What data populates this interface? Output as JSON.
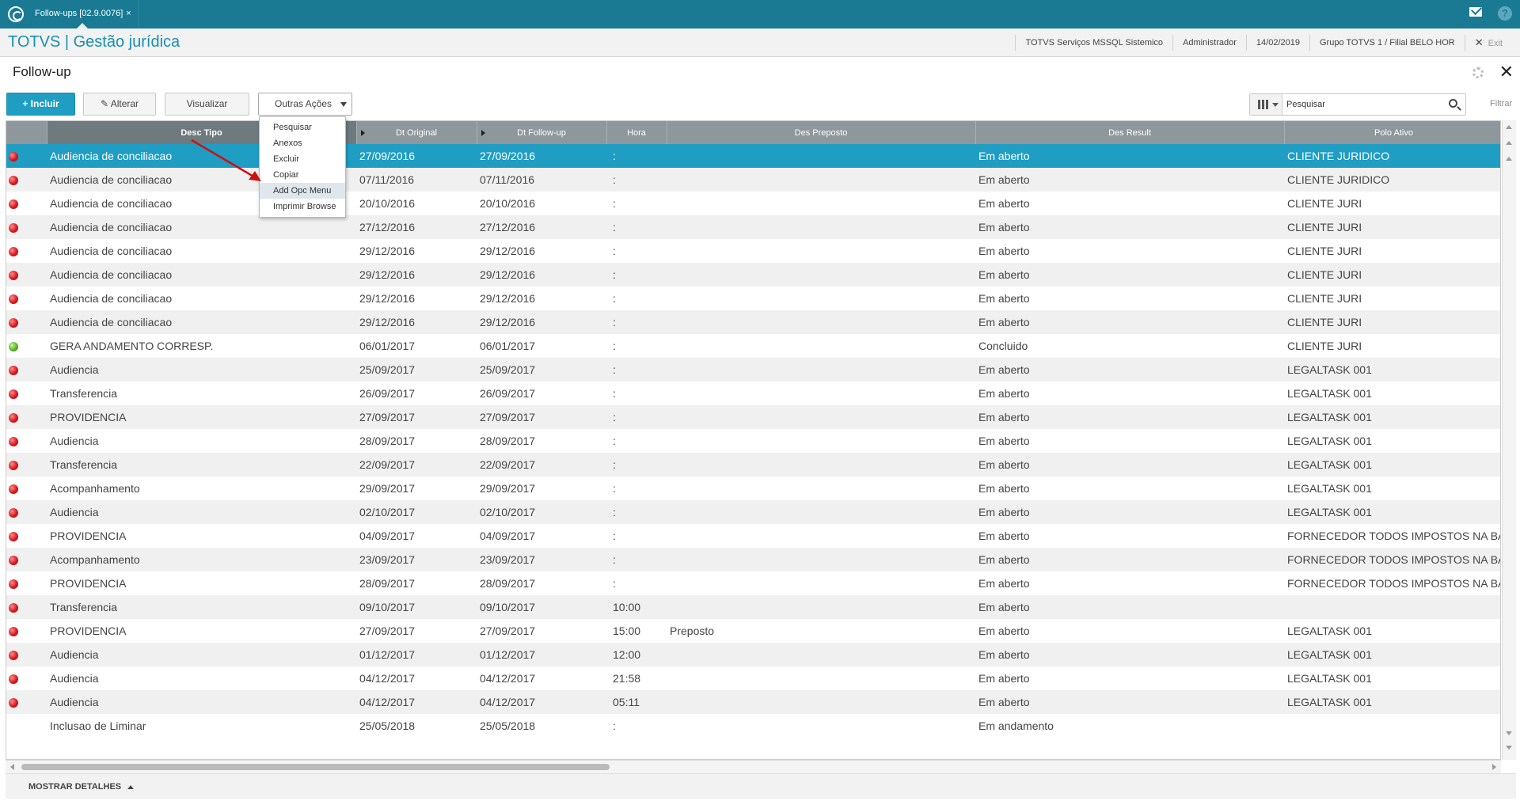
{
  "topbar": {
    "tab_label": "Follow-ups [02.9.0076]",
    "tab_close": "×",
    "help": "?"
  },
  "header": {
    "brand": "TOTVS | Gestão jurídica",
    "server": "TOTVS Serviços MSSQL Sistemico",
    "user": "Administrador",
    "date": "14/02/2019",
    "branch": "Grupo TOTVS 1 / Filial BELO HOR",
    "exit_icon": "✕",
    "exit": "Exit"
  },
  "page": {
    "title": "Follow-up",
    "close": "✕"
  },
  "toolbar": {
    "incluir_plus": "+",
    "incluir": "Incluir",
    "alterar_icon": "✎",
    "alterar": "Alterar",
    "visualizar": "Visualizar",
    "outras": "Outras Ações"
  },
  "dropdown": {
    "items": [
      "Pesquisar",
      "Anexos",
      "Excluir",
      "Copiar",
      "Add Opc Menu",
      "Imprimir Browse"
    ]
  },
  "search": {
    "placeholder": "Pesquisar",
    "filter": "Filtrar"
  },
  "grid": {
    "columns": [
      "Desc Tipo",
      "Dt Original",
      "Dt Follow-up",
      "Hora",
      "Des Preposto",
      "Des Result",
      "Polo Ativo"
    ],
    "rows": [
      {
        "status": "red",
        "tipo": "Audiencia de conciliacao",
        "dt_original": "27/09/2016",
        "dt_follow": "27/09/2016",
        "hora": ":",
        "preposto": "",
        "result": "Em aberto",
        "polo": "CLIENTE JURIDICO"
      },
      {
        "status": "red",
        "tipo": "Audiencia de conciliacao",
        "dt_original": "07/11/2016",
        "dt_follow": "07/11/2016",
        "hora": ":",
        "preposto": "",
        "result": "Em aberto",
        "polo": "CLIENTE JURIDICO"
      },
      {
        "status": "red",
        "tipo": "Audiencia de conciliacao",
        "dt_original": "20/10/2016",
        "dt_follow": "20/10/2016",
        "hora": ":",
        "preposto": "",
        "result": "Em aberto",
        "polo": "CLIENTE JURI"
      },
      {
        "status": "red",
        "tipo": "Audiencia de conciliacao",
        "dt_original": "27/12/2016",
        "dt_follow": "27/12/2016",
        "hora": ":",
        "preposto": "",
        "result": "Em aberto",
        "polo": "CLIENTE JURI"
      },
      {
        "status": "red",
        "tipo": "Audiencia de conciliacao",
        "dt_original": "29/12/2016",
        "dt_follow": "29/12/2016",
        "hora": ":",
        "preposto": "",
        "result": "Em aberto",
        "polo": "CLIENTE JURI"
      },
      {
        "status": "red",
        "tipo": "Audiencia de conciliacao",
        "dt_original": "29/12/2016",
        "dt_follow": "29/12/2016",
        "hora": ":",
        "preposto": "",
        "result": "Em aberto",
        "polo": "CLIENTE JURI"
      },
      {
        "status": "red",
        "tipo": "Audiencia de conciliacao",
        "dt_original": "29/12/2016",
        "dt_follow": "29/12/2016",
        "hora": ":",
        "preposto": "",
        "result": "Em aberto",
        "polo": "CLIENTE JURI"
      },
      {
        "status": "red",
        "tipo": "Audiencia de conciliacao",
        "dt_original": "29/12/2016",
        "dt_follow": "29/12/2016",
        "hora": ":",
        "preposto": "",
        "result": "Em aberto",
        "polo": "CLIENTE JURI"
      },
      {
        "status": "green",
        "tipo": "GERA ANDAMENTO CORRESP.",
        "dt_original": "06/01/2017",
        "dt_follow": "06/01/2017",
        "hora": ":",
        "preposto": "",
        "result": "Concluido",
        "polo": "CLIENTE JURI"
      },
      {
        "status": "red",
        "tipo": "Audiencia",
        "dt_original": "25/09/2017",
        "dt_follow": "25/09/2017",
        "hora": ":",
        "preposto": "",
        "result": "Em aberto",
        "polo": "LEGALTASK 001"
      },
      {
        "status": "red",
        "tipo": "Transferencia",
        "dt_original": "26/09/2017",
        "dt_follow": "26/09/2017",
        "hora": ":",
        "preposto": "",
        "result": "Em aberto",
        "polo": "LEGALTASK 001"
      },
      {
        "status": "red",
        "tipo": "PROVIDENCIA",
        "dt_original": "27/09/2017",
        "dt_follow": "27/09/2017",
        "hora": ":",
        "preposto": "",
        "result": "Em aberto",
        "polo": "LEGALTASK 001"
      },
      {
        "status": "red",
        "tipo": "Audiencia",
        "dt_original": "28/09/2017",
        "dt_follow": "28/09/2017",
        "hora": ":",
        "preposto": "",
        "result": "Em aberto",
        "polo": "LEGALTASK 001"
      },
      {
        "status": "red",
        "tipo": "Transferencia",
        "dt_original": "22/09/2017",
        "dt_follow": "22/09/2017",
        "hora": ":",
        "preposto": "",
        "result": "Em aberto",
        "polo": "LEGALTASK 001"
      },
      {
        "status": "red",
        "tipo": "Acompanhamento",
        "dt_original": "29/09/2017",
        "dt_follow": "29/09/2017",
        "hora": ":",
        "preposto": "",
        "result": "Em aberto",
        "polo": "LEGALTASK 001"
      },
      {
        "status": "red",
        "tipo": "Audiencia",
        "dt_original": "02/10/2017",
        "dt_follow": "02/10/2017",
        "hora": ":",
        "preposto": "",
        "result": "Em aberto",
        "polo": "LEGALTASK 001"
      },
      {
        "status": "red",
        "tipo": "PROVIDENCIA",
        "dt_original": "04/09/2017",
        "dt_follow": "04/09/2017",
        "hora": ":",
        "preposto": "",
        "result": "Em aberto",
        "polo": "FORNECEDOR TODOS IMPOSTOS NA BA"
      },
      {
        "status": "red",
        "tipo": "Acompanhamento",
        "dt_original": "23/09/2017",
        "dt_follow": "23/09/2017",
        "hora": ":",
        "preposto": "",
        "result": "Em aberto",
        "polo": "FORNECEDOR TODOS IMPOSTOS NA BA"
      },
      {
        "status": "red",
        "tipo": "PROVIDENCIA",
        "dt_original": "28/09/2017",
        "dt_follow": "28/09/2017",
        "hora": ":",
        "preposto": "",
        "result": "Em aberto",
        "polo": "FORNECEDOR TODOS IMPOSTOS NA BA"
      },
      {
        "status": "red",
        "tipo": "Transferencia",
        "dt_original": "09/10/2017",
        "dt_follow": "09/10/2017",
        "hora": "10:00",
        "preposto": "",
        "result": "Em aberto",
        "polo": ""
      },
      {
        "status": "red",
        "tipo": "PROVIDENCIA",
        "dt_original": "27/09/2017",
        "dt_follow": "27/09/2017",
        "hora": "15:00",
        "preposto": "Preposto",
        "result": "Em aberto",
        "polo": "LEGALTASK 001"
      },
      {
        "status": "red",
        "tipo": "Audiencia",
        "dt_original": "01/12/2017",
        "dt_follow": "01/12/2017",
        "hora": "12:00",
        "preposto": "",
        "result": "Em aberto",
        "polo": "LEGALTASK 001"
      },
      {
        "status": "red",
        "tipo": "Audiencia",
        "dt_original": "04/12/2017",
        "dt_follow": "04/12/2017",
        "hora": "21:58",
        "preposto": "",
        "result": "Em aberto",
        "polo": "LEGALTASK 001"
      },
      {
        "status": "red",
        "tipo": "Audiencia",
        "dt_original": "04/12/2017",
        "dt_follow": "04/12/2017",
        "hora": "05:11",
        "preposto": "",
        "result": "Em aberto",
        "polo": "LEGALTASK 001"
      },
      {
        "status": "none",
        "tipo": "Inclusao de Liminar",
        "dt_original": "25/05/2018",
        "dt_follow": "25/05/2018",
        "hora": ":",
        "preposto": "",
        "result": "Em andamento",
        "polo": ""
      }
    ]
  },
  "footer": {
    "details": "MOSTRAR DETALHES"
  },
  "colors": {
    "topbar": "#1a7a93",
    "selected_row": "#1f9dc3",
    "brand": "#1a8fb0",
    "status_red": "#d9181e",
    "status_green": "#5cb42a"
  }
}
